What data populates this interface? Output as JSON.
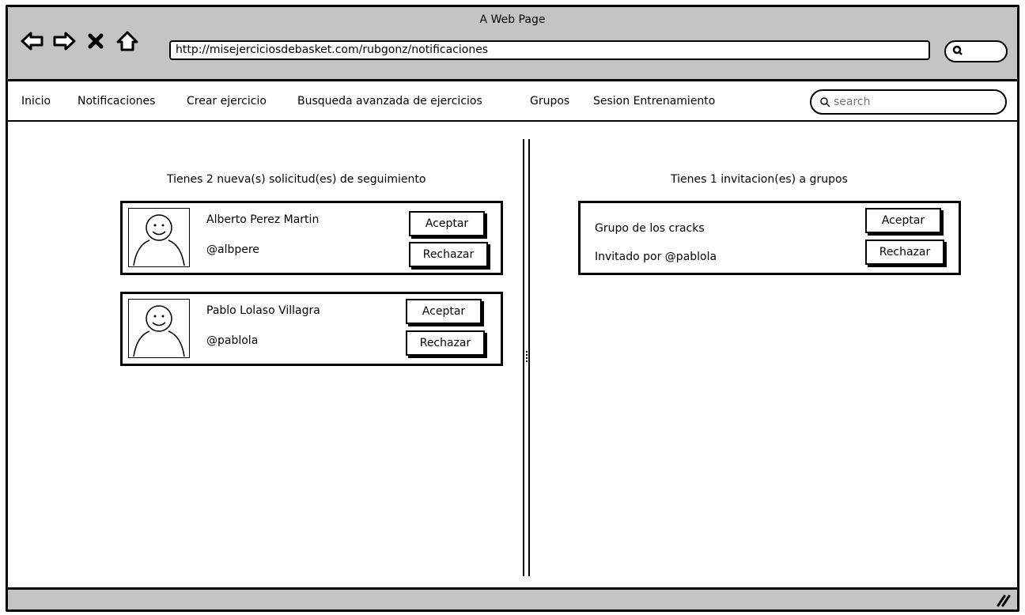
{
  "window": {
    "title": "A Web Page"
  },
  "browser": {
    "url": "http://misejerciciosdebasket.com/rubgonz/notificaciones"
  },
  "menu": {
    "items": [
      {
        "label": "Inicio"
      },
      {
        "label": "Notificaciones"
      },
      {
        "label": "Crear ejercicio"
      },
      {
        "label": "Busqueda avanzada de ejercicios"
      },
      {
        "label": "Grupos"
      },
      {
        "label": "Sesion Entrenamiento"
      }
    ],
    "search_placeholder": "search"
  },
  "follow_requests": {
    "title": "Tienes 2 nueva(s) solicitud(es) de seguimiento",
    "items": [
      {
        "name": "Alberto Perez Martin",
        "handle": "@albpere",
        "accept_label": "Aceptar",
        "reject_label": "Rechazar"
      },
      {
        "name": "Pablo Lolaso Villagra",
        "handle": "@pablola",
        "accept_label": "Aceptar",
        "reject_label": "Rechazar"
      }
    ]
  },
  "group_invites": {
    "title": "Tienes 1 invitacion(es) a grupos",
    "items": [
      {
        "group": "Grupo de los cracks",
        "invited_by": "Invitado por @pablola",
        "accept_label": "Aceptar",
        "reject_label": "Rechazar"
      }
    ]
  },
  "icons": {
    "back": "back-arrow-icon",
    "forward": "forward-arrow-icon",
    "stop": "close-icon",
    "home": "home-icon",
    "search": "search-icon",
    "resize": "resize-grip-icon",
    "avatar": "user-avatar-icon"
  }
}
